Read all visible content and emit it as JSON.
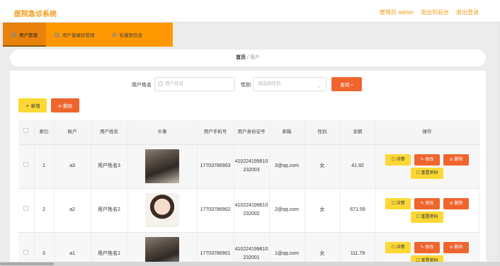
{
  "header": {
    "title": "医院急诊系统",
    "admin_label": "管理员 admin",
    "back_label": "退出到前台",
    "logout_label": "退出登录"
  },
  "nav": {
    "items": [
      {
        "label": "用户管理",
        "icon": "user-icon"
      },
      {
        "label": "用户健康码管理",
        "icon": "qrcode-icon"
      },
      {
        "label": "轮播图信息",
        "icon": "image-icon"
      }
    ]
  },
  "breadcrumb": {
    "home": "首页",
    "sep": "/",
    "current": "用户"
  },
  "search": {
    "name_label": "用户姓名",
    "name_placeholder": "用户姓名",
    "gender_label": "性别",
    "gender_placeholder": "请选择性别",
    "query_label": "查询 ⌕"
  },
  "actions": {
    "add_label": "＋ 新增",
    "delete_label": "⊘ 删除"
  },
  "table": {
    "headers": [
      "",
      "索引",
      "账户",
      "用户姓名",
      "头像",
      "用户手机号",
      "用户身份证号",
      "邮箱",
      "性别",
      "余额",
      "操作"
    ],
    "rows": [
      {
        "index": "1",
        "account": "a3",
        "name": "用户姓名3",
        "avatar": "avatar-dark",
        "phone": "17703786903",
        "idcard": "410224199610232003",
        "email": "3@qq.com",
        "gender": "女",
        "balance": "41.92"
      },
      {
        "index": "2",
        "account": "a2",
        "name": "用户姓名2",
        "avatar": "avatar-light",
        "phone": "17703786902",
        "idcard": "410224199610232002",
        "email": "2@qq.com",
        "gender": "女",
        "balance": "671.59"
      },
      {
        "index": "3",
        "account": "a1",
        "name": "用户姓名1",
        "avatar": "avatar-dark",
        "phone": "17703786901",
        "idcard": "410224199610232001",
        "email": "1@qq.com",
        "gender": "女",
        "balance": "111.79"
      }
    ],
    "ops": {
      "detail": "☐ 详情",
      "edit": "✎ 修改",
      "delete": "⊘ 删除",
      "reset": "☐ 重置密码"
    }
  },
  "colors": {
    "accent": "#f29b18",
    "nav_bg": "#ff9800",
    "danger": "#f0652d",
    "warning": "#fdd835"
  }
}
